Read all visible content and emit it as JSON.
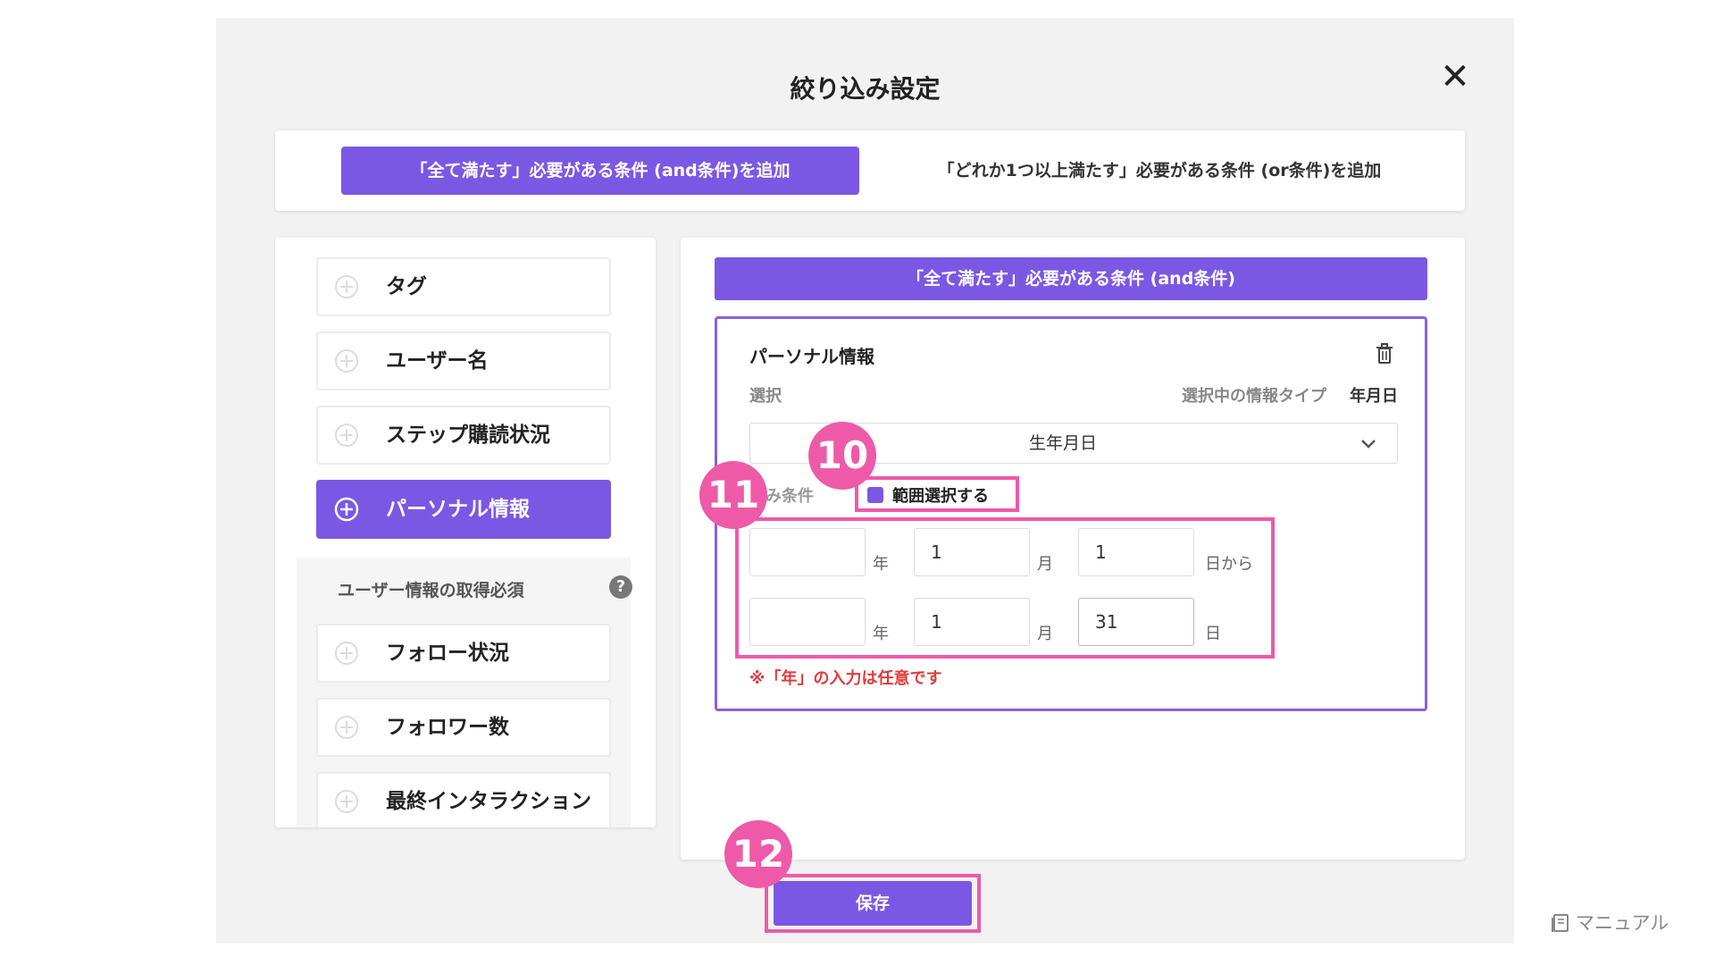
{
  "modal": {
    "title": "絞り込み設定"
  },
  "tabs": {
    "and_label": "「全て満たす」必要がある条件 (and条件)を追加",
    "or_label": "「どれか1つ以上満たす」必要がある条件 (or条件)を追加"
  },
  "sidebar": {
    "items": [
      {
        "label": "タグ",
        "active": false
      },
      {
        "label": "ユーザー名",
        "active": false
      },
      {
        "label": "ステップ購読状況",
        "active": false
      },
      {
        "label": "パーソナル情報",
        "active": true
      }
    ],
    "subsection": {
      "title": "ユーザー情報の取得必須",
      "items": [
        {
          "label": "フォロー状況"
        },
        {
          "label": "フォロワー数"
        },
        {
          "label": "最終インタラクション"
        }
      ]
    }
  },
  "condition": {
    "header": "「全て満たす」必要がある条件 (and条件)",
    "card_title": "パーソナル情報",
    "select_label": "選択",
    "info_type_label": "選択中の情報タイプ",
    "info_type_value": "年月日",
    "dropdown_value": "生年月日",
    "filter_label": "込み条件",
    "range_label": "範囲選択する",
    "range_checked": true,
    "from": {
      "year": "",
      "month": "1",
      "day": "1"
    },
    "to": {
      "year": "",
      "month": "1",
      "day": "31"
    },
    "units": {
      "year": "年",
      "month": "月",
      "day_from": "日から",
      "day_to": "日"
    },
    "note": "※「年」の入力は任意です"
  },
  "annotations": {
    "badge_10": "10",
    "badge_11": "11",
    "badge_12": "12"
  },
  "footer": {
    "save_label": "保存",
    "manual_label": "マニュアル"
  },
  "icons": {
    "close": "close-icon",
    "plus": "plus-circle-icon",
    "help": "help-icon",
    "trash": "trash-icon",
    "chevron": "chevron-down-icon",
    "manual": "book-icon"
  },
  "colors": {
    "accent": "#7a58e3",
    "highlight": "#ee5aa8",
    "note": "#e23b3b"
  }
}
